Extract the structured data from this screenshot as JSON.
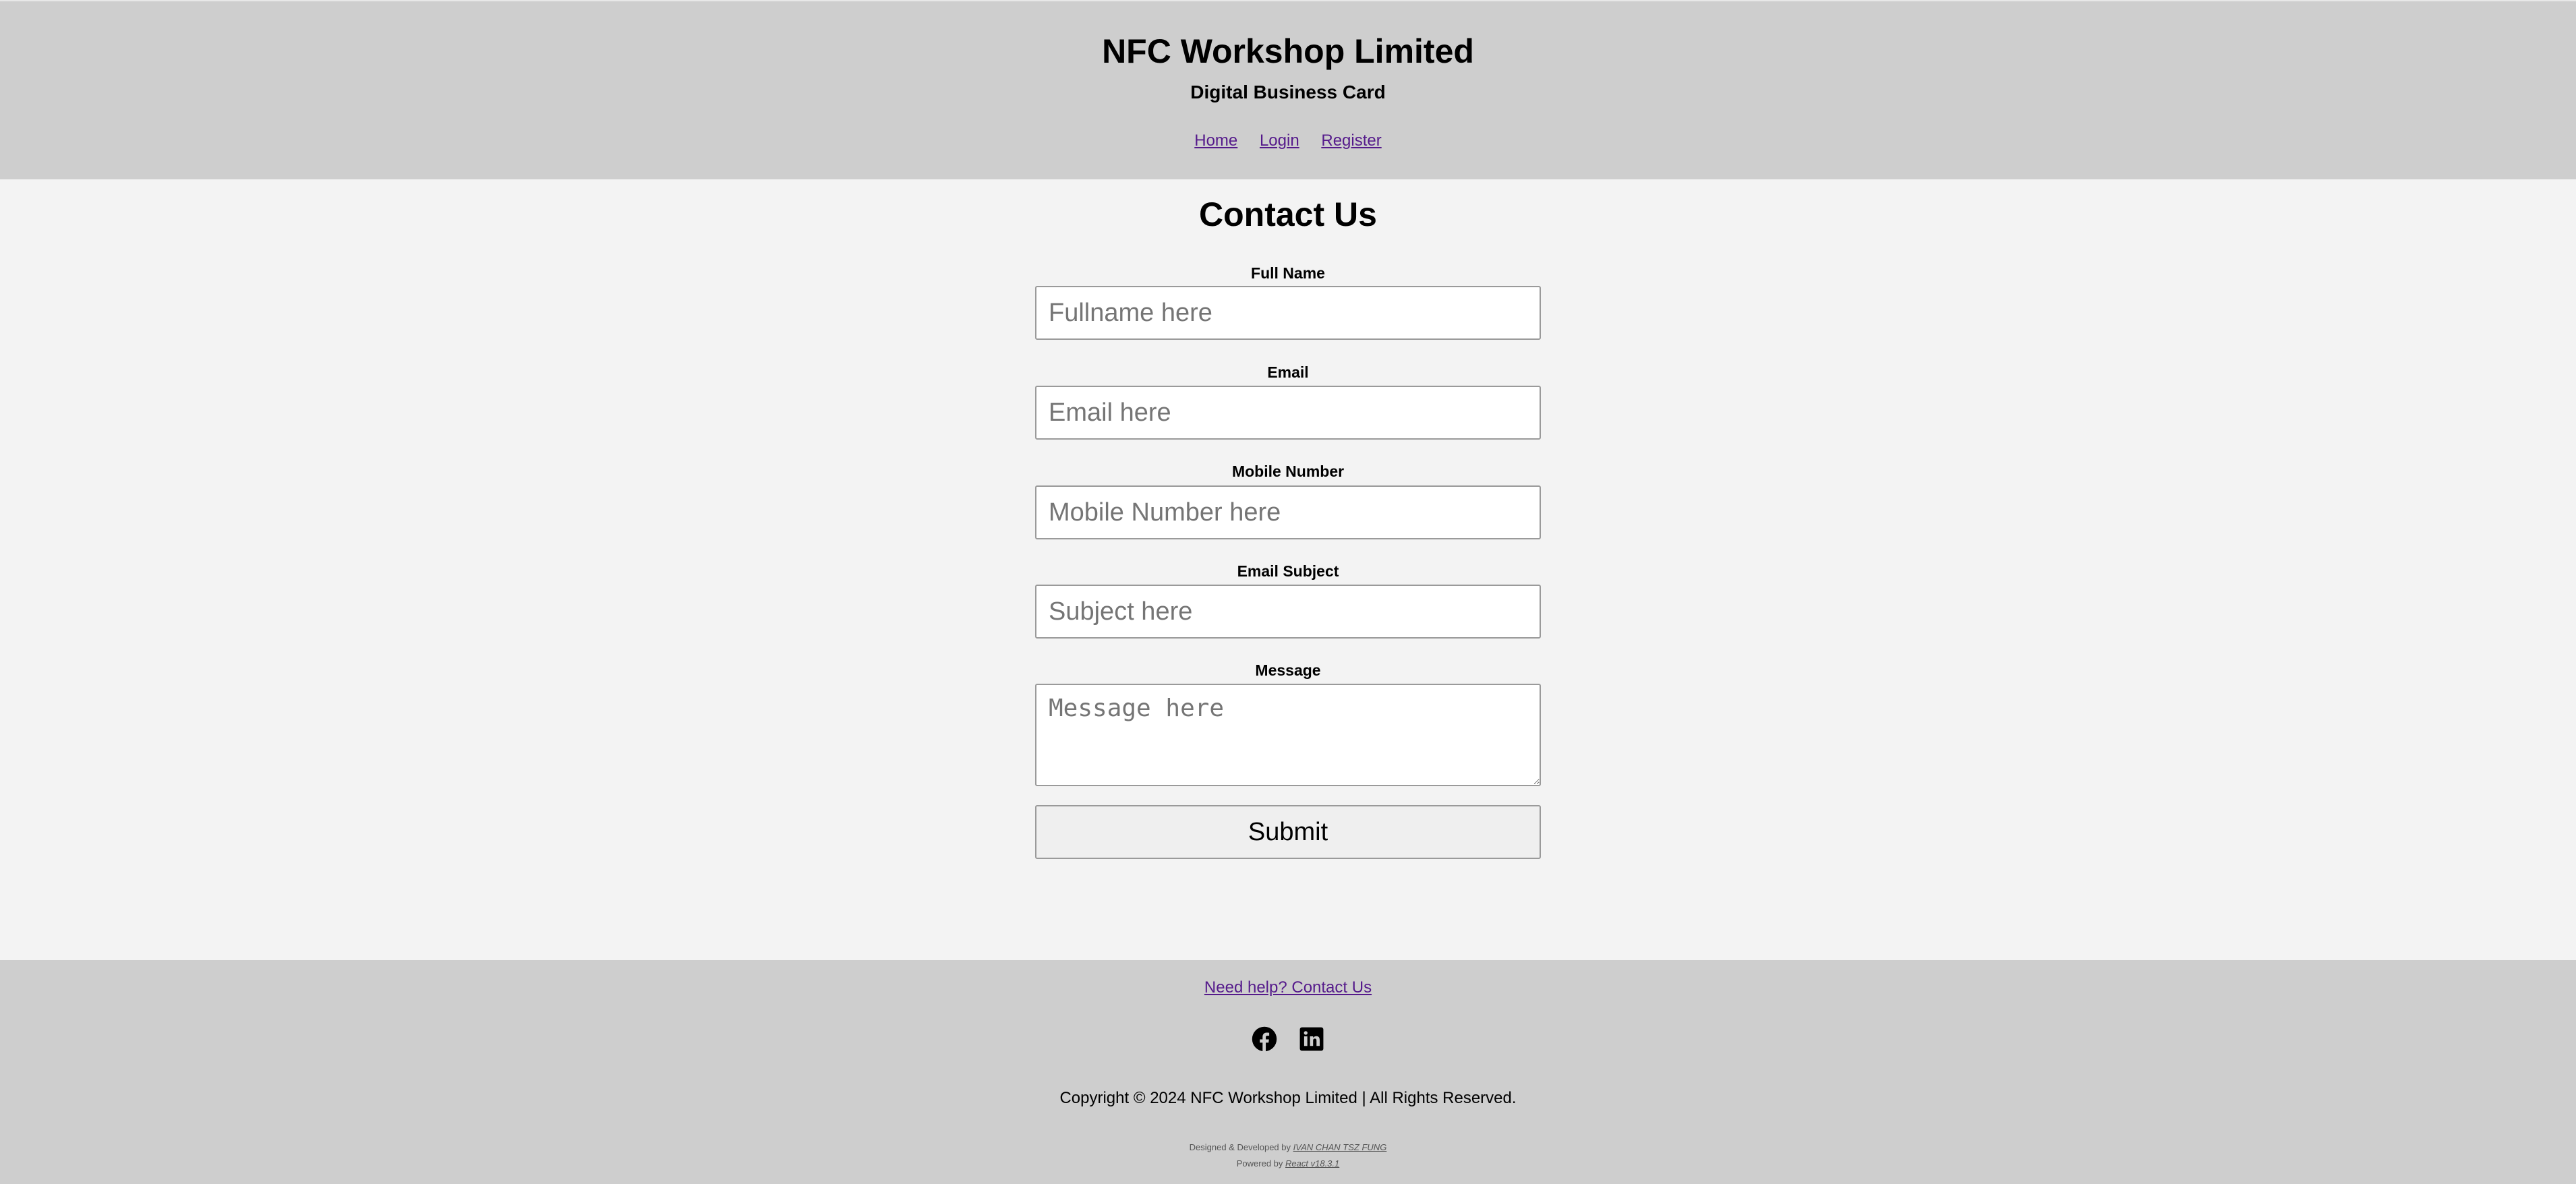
{
  "header": {
    "title": "NFC Workshop Limited",
    "subtitle": "Digital Business Card",
    "nav": [
      {
        "label": "Home"
      },
      {
        "label": "Login"
      },
      {
        "label": "Register"
      }
    ]
  },
  "main": {
    "title": "Contact Us",
    "fields": {
      "fullname": {
        "label": "Full Name",
        "placeholder": "Fullname here"
      },
      "email": {
        "label": "Email",
        "placeholder": "Email here"
      },
      "mobile": {
        "label": "Mobile Number",
        "placeholder": "Mobile Number here"
      },
      "subject": {
        "label": "Email Subject",
        "placeholder": "Subject here"
      },
      "message": {
        "label": "Message",
        "placeholder": "Message here"
      }
    },
    "submit_label": "Submit"
  },
  "footer": {
    "help_link": "Need help? Contact Us",
    "social_icons": [
      "facebook-icon",
      "linkedin-icon"
    ],
    "copyright": "Copyright © 2024 NFC Workshop Limited | All Rights Reserved.",
    "designed_by_prefix": "Designed & Developed by",
    "designer_name": "IVAN CHAN TSZ FUNG",
    "powered_by_prefix": "Powered by",
    "powered_by_name": "React v18.3.1"
  },
  "colors": {
    "header_footer_bg": "#cecece",
    "page_bg": "#f3f3f3",
    "link": "#551a8b"
  }
}
